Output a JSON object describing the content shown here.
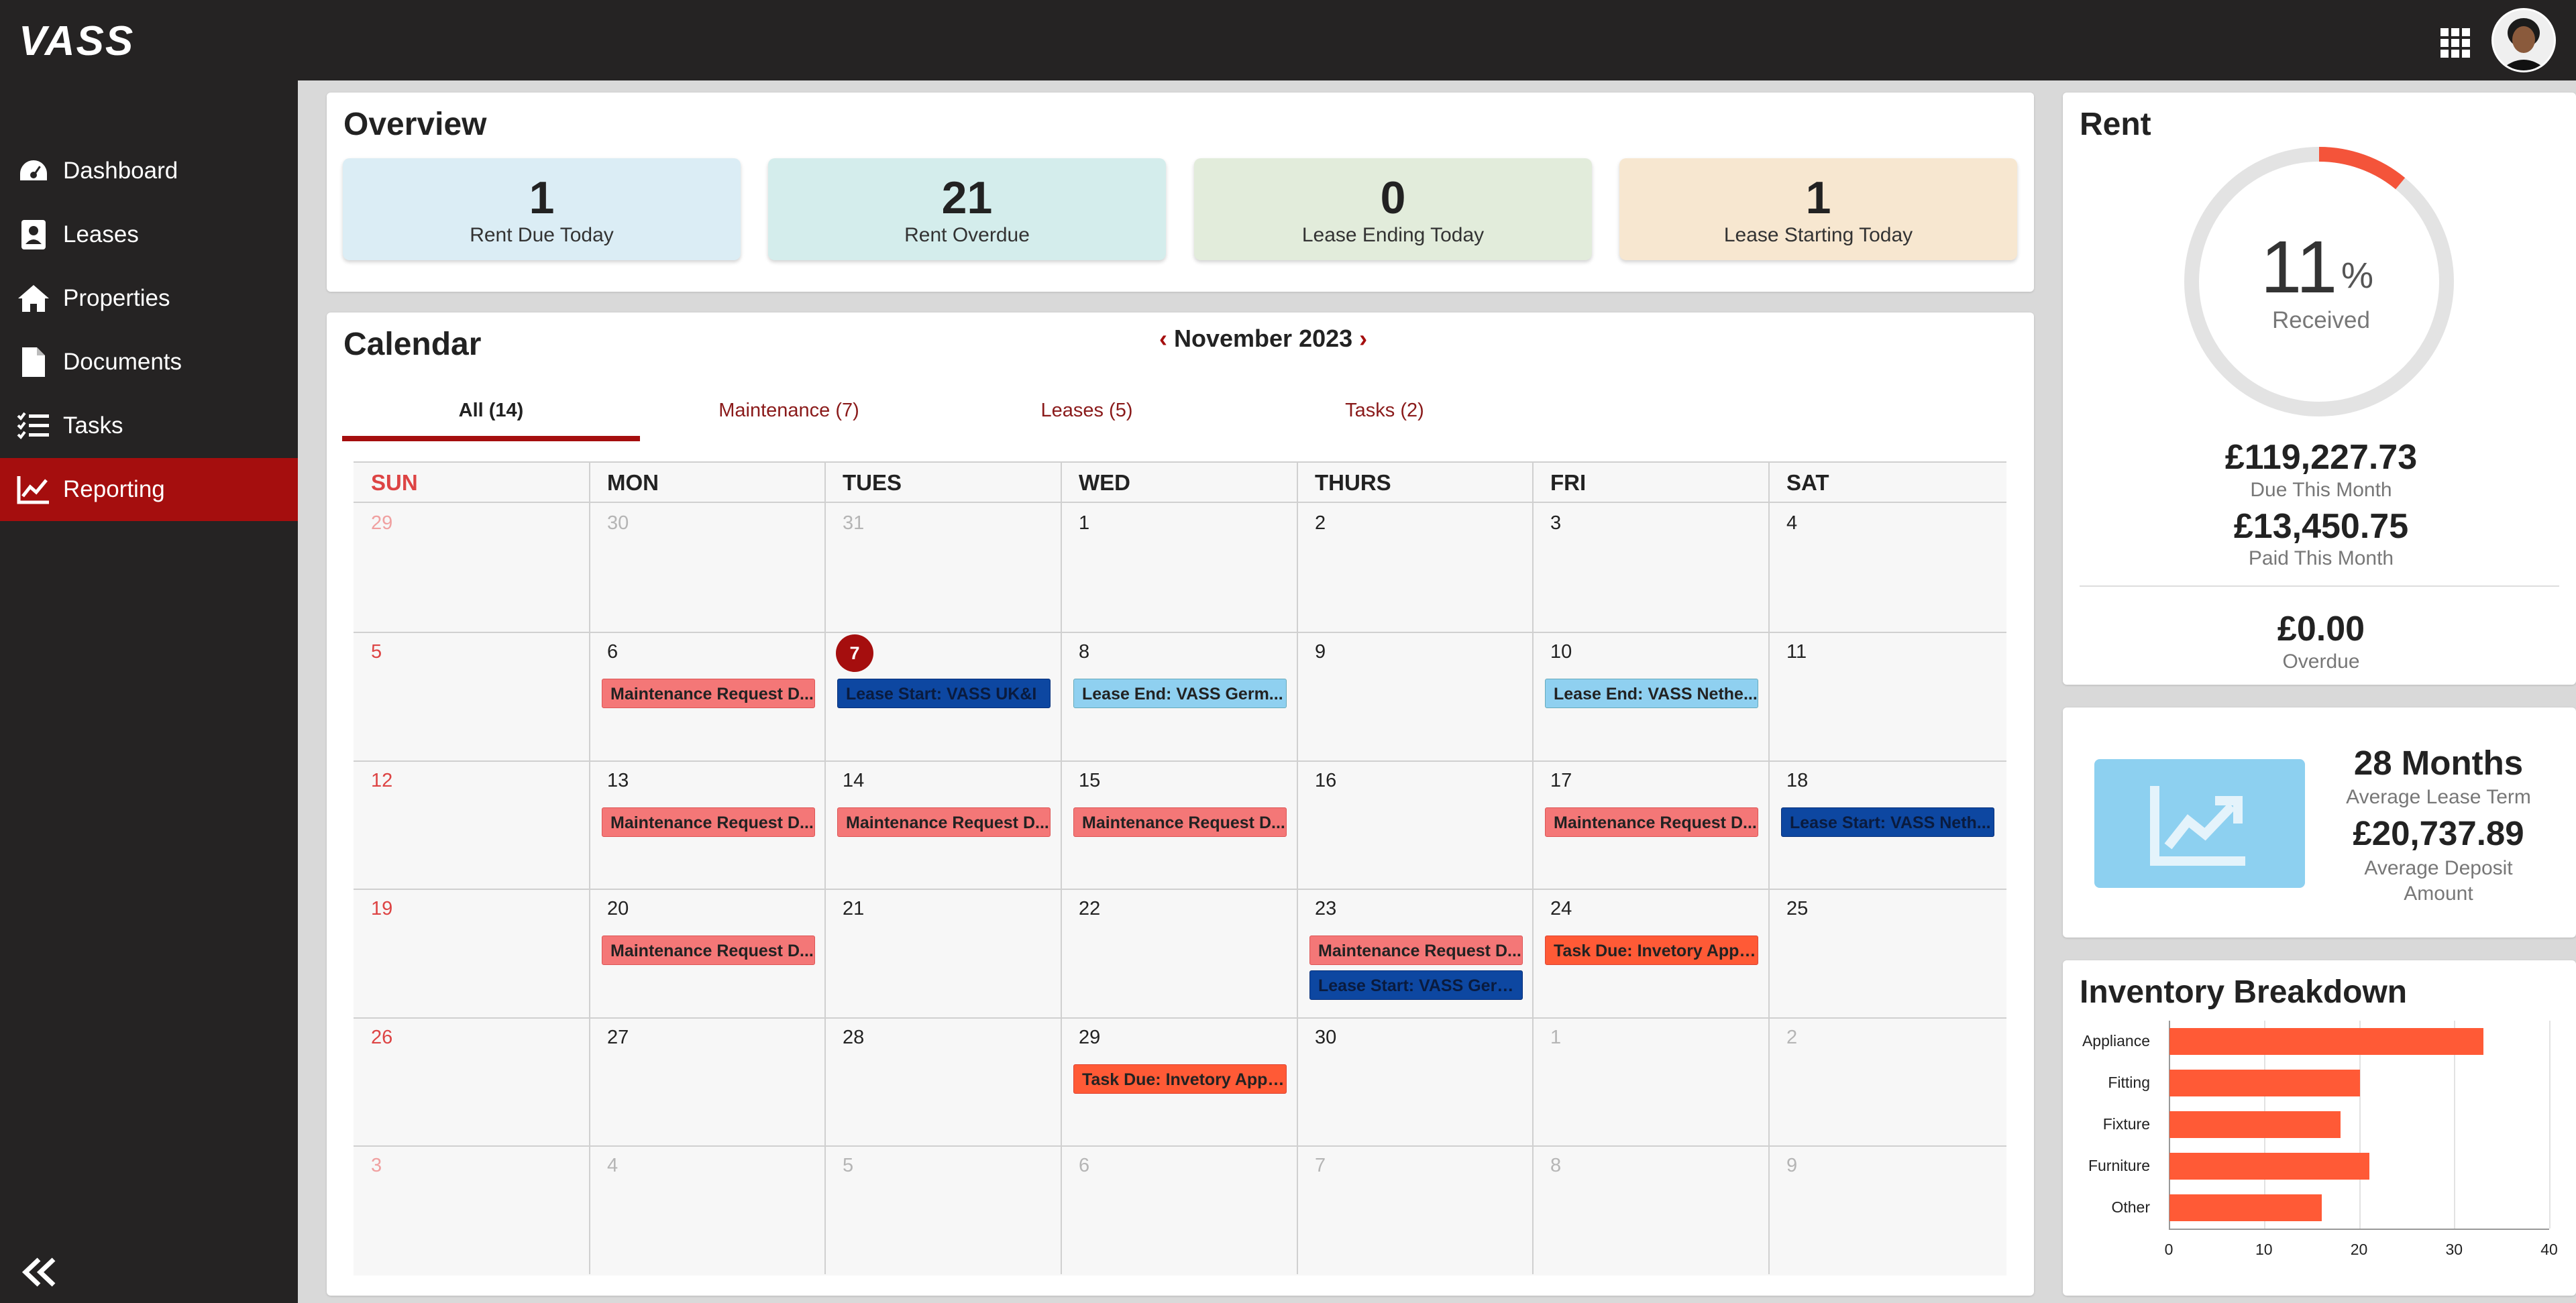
{
  "app": {
    "logo": "VASS"
  },
  "sidebar": {
    "items": [
      {
        "label": "Dashboard",
        "icon": "dashboard-icon",
        "active": false
      },
      {
        "label": "Leases",
        "icon": "lease-icon",
        "active": false
      },
      {
        "label": "Properties",
        "icon": "home-icon",
        "active": false
      },
      {
        "label": "Documents",
        "icon": "document-icon",
        "active": false
      },
      {
        "label": "Tasks",
        "icon": "tasks-icon",
        "active": false
      },
      {
        "label": "Reporting",
        "icon": "chart-line-icon",
        "active": true
      }
    ]
  },
  "overview": {
    "title": "Overview",
    "stats": [
      {
        "value": "1",
        "label": "Rent Due Today",
        "color": "#dbedf5"
      },
      {
        "value": "21",
        "label": "Rent Overdue",
        "color": "#d4edec"
      },
      {
        "value": "0",
        "label": "Lease Ending Today",
        "color": "#e2ecdb"
      },
      {
        "value": "1",
        "label": "Lease Starting Today",
        "color": "#f7e7d0"
      }
    ]
  },
  "calendar": {
    "title": "Calendar",
    "month": "November 2023",
    "tabs": [
      {
        "label": "All (14)",
        "active": true
      },
      {
        "label": "Maintenance (7)",
        "active": false
      },
      {
        "label": "Leases (5)",
        "active": false
      },
      {
        "label": "Tasks (2)",
        "active": false
      }
    ],
    "weekdays": [
      "SUN",
      "MON",
      "TUES",
      "WED",
      "THURS",
      "FRI",
      "SAT"
    ],
    "weeks": [
      [
        {
          "d": "29",
          "m": true
        },
        {
          "d": "30",
          "m": true
        },
        {
          "d": "31",
          "m": true
        },
        {
          "d": "1"
        },
        {
          "d": "2"
        },
        {
          "d": "3"
        },
        {
          "d": "4"
        }
      ],
      [
        {
          "d": "5"
        },
        {
          "d": "6"
        },
        {
          "d": "7",
          "today": true
        },
        {
          "d": "8"
        },
        {
          "d": "9"
        },
        {
          "d": "10"
        },
        {
          "d": "11"
        }
      ],
      [
        {
          "d": "12"
        },
        {
          "d": "13"
        },
        {
          "d": "14"
        },
        {
          "d": "15"
        },
        {
          "d": "16"
        },
        {
          "d": "17"
        },
        {
          "d": "18"
        }
      ],
      [
        {
          "d": "19"
        },
        {
          "d": "20"
        },
        {
          "d": "21"
        },
        {
          "d": "22"
        },
        {
          "d": "23"
        },
        {
          "d": "24"
        },
        {
          "d": "25"
        }
      ],
      [
        {
          "d": "26"
        },
        {
          "d": "27"
        },
        {
          "d": "28"
        },
        {
          "d": "29"
        },
        {
          "d": "30"
        },
        {
          "d": "1",
          "m": true
        },
        {
          "d": "2",
          "m": true
        }
      ],
      [
        {
          "d": "3",
          "m": true
        },
        {
          "d": "4",
          "m": true
        },
        {
          "d": "5",
          "m": true
        },
        {
          "d": "6",
          "m": true
        },
        {
          "d": "7",
          "m": true
        },
        {
          "d": "8",
          "m": true
        },
        {
          "d": "9",
          "m": true
        }
      ]
    ],
    "events": [
      {
        "week": 1,
        "day": 1,
        "slot": 0,
        "type": "maint",
        "text": "Maintenance Request D..."
      },
      {
        "week": 1,
        "day": 2,
        "slot": 0,
        "type": "lstart",
        "text": "Lease Start: VASS UK&I"
      },
      {
        "week": 1,
        "day": 3,
        "slot": 0,
        "type": "lend",
        "text": "Lease End: VASS Germ..."
      },
      {
        "week": 1,
        "day": 5,
        "slot": 0,
        "type": "lend",
        "text": "Lease End: VASS Nethe..."
      },
      {
        "week": 2,
        "day": 1,
        "slot": 0,
        "type": "maint",
        "text": "Maintenance Request D..."
      },
      {
        "week": 2,
        "day": 2,
        "slot": 0,
        "type": "maint",
        "text": "Maintenance Request D..."
      },
      {
        "week": 2,
        "day": 3,
        "slot": 0,
        "type": "maint",
        "text": "Maintenance Request D..."
      },
      {
        "week": 2,
        "day": 5,
        "slot": 0,
        "type": "maint",
        "text": "Maintenance Request D..."
      },
      {
        "week": 2,
        "day": 6,
        "slot": 0,
        "type": "lstart",
        "text": "Lease Start: VASS Neth..."
      },
      {
        "week": 3,
        "day": 1,
        "slot": 0,
        "type": "maint",
        "text": "Maintenance Request D..."
      },
      {
        "week": 3,
        "day": 4,
        "slot": 0,
        "type": "maint",
        "text": "Maintenance Request D..."
      },
      {
        "week": 3,
        "day": 4,
        "slot": 1,
        "type": "lstart",
        "text": "Lease Start: VASS Germ..."
      },
      {
        "week": 3,
        "day": 5,
        "slot": 0,
        "type": "task",
        "text": "Task Due: Invetory Appr..."
      },
      {
        "week": 4,
        "day": 3,
        "slot": 0,
        "type": "task",
        "text": "Task Due: Invetory Appr..."
      }
    ]
  },
  "rent": {
    "title": "Rent",
    "percent": "11",
    "percent_symbol": "%",
    "percent_fraction": 0.11,
    "received_label": "Received",
    "due_value": "£119,227.73",
    "due_label": "Due This Month",
    "paid_value": "£13,450.75",
    "paid_label": "Paid This Month",
    "overdue_value": "£0.00",
    "overdue_label": "Overdue",
    "gauge_color": "#f4543a",
    "track_color": "#e3e3e3"
  },
  "lease_stats": {
    "term_value": "28 Months",
    "term_label": "Average Lease Term",
    "deposit_value": "£20,737.89",
    "deposit_label": "Average Deposit Amount"
  },
  "inventory": {
    "title": "Inventory Breakdown",
    "chart_data": {
      "type": "bar",
      "orientation": "horizontal",
      "categories": [
        "Appliance",
        "Fitting",
        "Fixture",
        "Furniture",
        "Other"
      ],
      "values": [
        33,
        20,
        18,
        21,
        16
      ],
      "xlim": [
        0,
        40
      ],
      "xticks": [
        "0",
        "10",
        "20",
        "30",
        "40"
      ],
      "grid": true,
      "bar_color": "#ff5a36"
    }
  }
}
